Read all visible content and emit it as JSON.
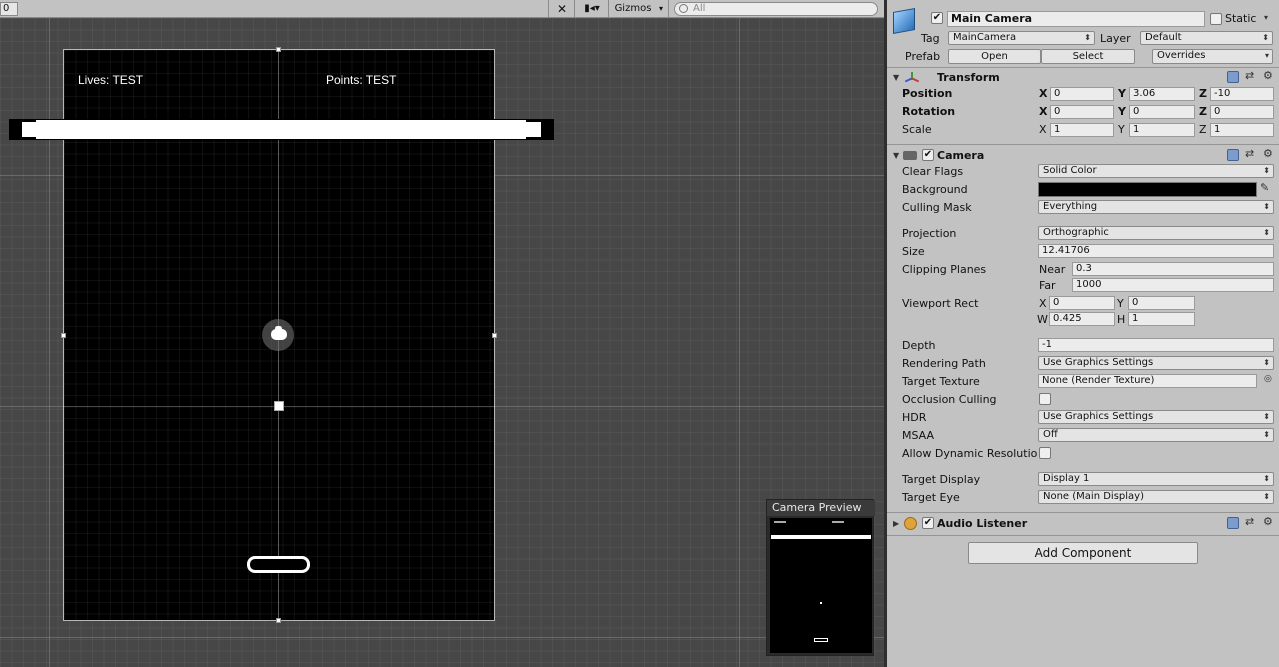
{
  "scene": {
    "layer_value": "0",
    "shading_icon": "scene-tools-icon",
    "camera_icon": "camera-mode-icon",
    "gizmos_label": "Gizmos",
    "search_placeholder": "All",
    "hud_lives": "Lives: TEST",
    "hud_points": "Points: TEST",
    "preview_title": "Camera Preview"
  },
  "inspector": {
    "object_name": "Main Camera",
    "static_label": "Static",
    "tag_label": "Tag",
    "tag_value": "MainCamera",
    "layer_label": "Layer",
    "layer_value": "Default",
    "prefab_label": "Prefab",
    "prefab_open": "Open",
    "prefab_select": "Select",
    "prefab_overrides": "Overrides",
    "transform": {
      "title": "Transform",
      "position_label": "Position",
      "rotation_label": "Rotation",
      "scale_label": "Scale",
      "axis_x": "X",
      "axis_y": "Y",
      "axis_z": "Z",
      "position": {
        "x": "0",
        "y": "3.06",
        "z": "-10"
      },
      "rotation": {
        "x": "0",
        "y": "0",
        "z": "0"
      },
      "scale": {
        "x": "1",
        "y": "1",
        "z": "1"
      }
    },
    "camera": {
      "title": "Camera",
      "clear_flags_label": "Clear Flags",
      "clear_flags_value": "Solid Color",
      "background_label": "Background",
      "background_color": "#000000",
      "culling_mask_label": "Culling Mask",
      "culling_mask_value": "Everything",
      "projection_label": "Projection",
      "projection_value": "Orthographic",
      "size_label": "Size",
      "size_value": "12.41706",
      "clipping_label": "Clipping Planes",
      "near_label": "Near",
      "near_value": "0.3",
      "far_label": "Far",
      "far_value": "1000",
      "viewport_label": "Viewport Rect",
      "vp_x_label": "X",
      "vp_x": "0",
      "vp_y_label": "Y",
      "vp_y": "0",
      "vp_w_label": "W",
      "vp_w": "0.425",
      "vp_h_label": "H",
      "vp_h": "1",
      "depth_label": "Depth",
      "depth_value": "-1",
      "rendering_path_label": "Rendering Path",
      "rendering_path_value": "Use Graphics Settings",
      "target_texture_label": "Target Texture",
      "target_texture_value": "None (Render Texture)",
      "occlusion_label": "Occlusion Culling",
      "hdr_label": "HDR",
      "hdr_value": "Use Graphics Settings",
      "msaa_label": "MSAA",
      "msaa_value": "Off",
      "dynres_label": "Allow Dynamic Resolutio",
      "target_display_label": "Target Display",
      "target_display_value": "Display 1",
      "target_eye_label": "Target Eye",
      "target_eye_value": "None (Main Display)"
    },
    "audio_listener_title": "Audio Listener",
    "add_component": "Add Component"
  }
}
